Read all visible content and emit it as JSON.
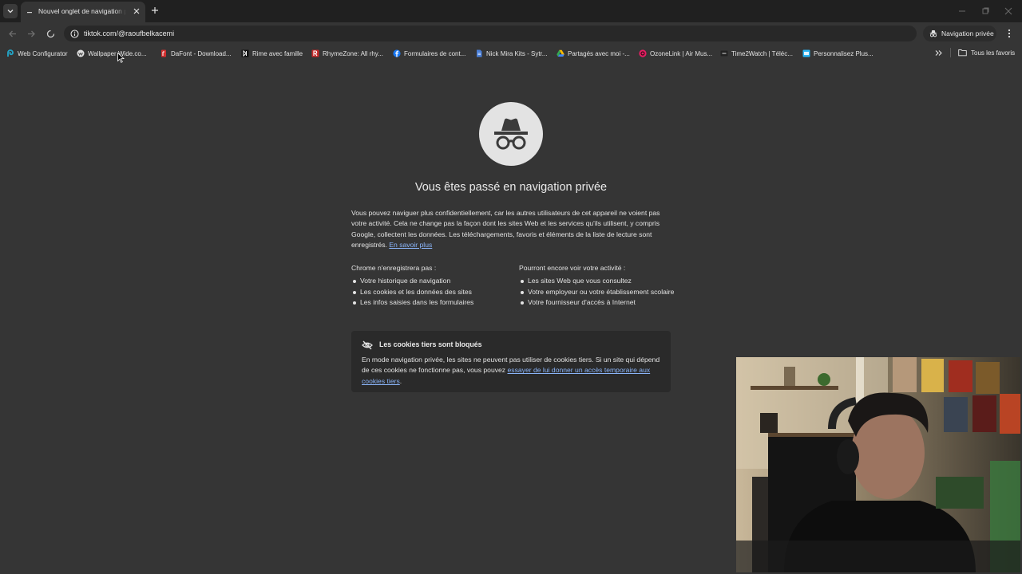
{
  "tab": {
    "title": "Nouvel onglet de navigation privée"
  },
  "toolbar": {
    "url": "tiktok.com/@raoufbelkacemi",
    "incognito_label": "Navigation privée"
  },
  "bookmarks": [
    {
      "label": "Web Configurator",
      "icon": "tplink-icon",
      "color": "#23a6c8"
    },
    {
      "label": "Wallpaper Wide.co...",
      "icon": "wallpaperwide-icon",
      "color": "#e0e0e0"
    },
    {
      "label": "DaFont - Download...",
      "icon": "dafont-icon",
      "color": "#d32f2f"
    },
    {
      "label": "Rime avec famille",
      "icon": "rime-icon",
      "color": "#111111"
    },
    {
      "label": "RhymeZone: All rhy...",
      "icon": "rhymezone-icon",
      "color": "#c62828"
    },
    {
      "label": "Formulaires de cont...",
      "icon": "facebook-icon",
      "color": "#1877f2"
    },
    {
      "label": "Nick Mira Kits - Sytr...",
      "icon": "document-icon",
      "color": "#4a7fd8"
    },
    {
      "label": "Partagés avec moi -...",
      "icon": "google-drive-icon",
      "color": "#34a853"
    },
    {
      "label": "OzoneLink | Air Mus...",
      "icon": "ozonelink-icon",
      "color": "#e91e63"
    },
    {
      "label": "Time2Watch | Téléc...",
      "icon": "time2watch-icon",
      "color": "#222222"
    },
    {
      "label": "Personnalisez Plus...",
      "icon": "personnalisez-icon",
      "color": "#29b6f6"
    }
  ],
  "all_bookmarks_label": "Tous les favoris",
  "page": {
    "heading": "Vous êtes passé en navigation privée",
    "intro": "Vous pouvez naviguer plus confidentiellement, car les autres utilisateurs de cet appareil ne voient pas votre activité. Cela ne change pas la façon dont les sites Web et les services qu'ils utilisent, y compris Google, collectent les données. Les téléchargements, favoris et éléments de la liste de lecture sont enregistrés.",
    "learn_more": "En savoir plus",
    "left_title": "Chrome n'enregistrera pas :",
    "left_items": [
      "Votre historique de navigation",
      "Les cookies et les données des sites",
      "Les infos saisies dans les formulaires"
    ],
    "right_title": "Pourront encore voir votre activité :",
    "right_items": [
      "Les sites Web que vous consultez",
      "Votre employeur ou votre établissement scolaire",
      "Votre fournisseur d'accès à Internet"
    ],
    "cookie_title": "Les cookies tiers sont bloqués",
    "cookie_text": "En mode navigation privée, les sites ne peuvent pas utiliser de cookies tiers. Si un site qui dépend de ces cookies ne fonctionne pas, vous pouvez",
    "cookie_link": "essayer de lui donner un accès temporaire aux cookies tiers",
    "cookie_end": "."
  },
  "colors": {
    "page_bg": "#353535",
    "tabstrip_bg": "#202020",
    "link": "#8ab4f8",
    "card_bg": "#2a2a2a"
  }
}
